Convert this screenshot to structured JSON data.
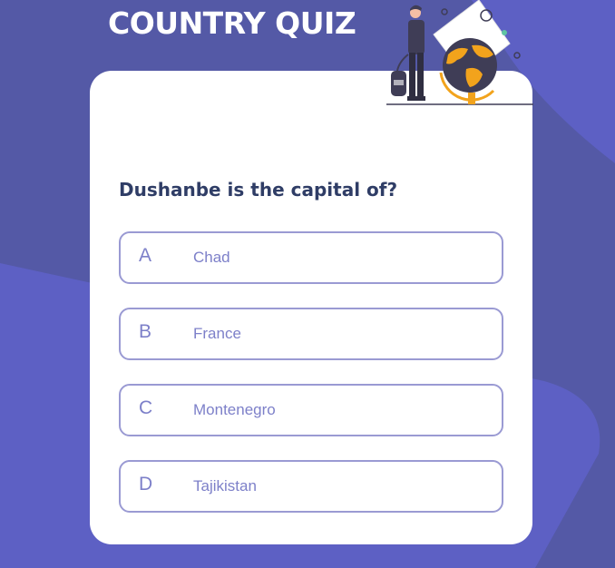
{
  "app": {
    "title": "COUNTRY QUIZ"
  },
  "quiz": {
    "question": "Dushanbe is the capital of?",
    "options": [
      {
        "letter": "A",
        "text": "Chad"
      },
      {
        "letter": "B",
        "text": "France"
      },
      {
        "letter": "C",
        "text": "Montenegro"
      },
      {
        "letter": "D",
        "text": "Tajikistan"
      }
    ]
  },
  "colors": {
    "background": "#5459a6",
    "background_accent": "#5d60c4",
    "card": "#ffffff",
    "question_text": "#2f3d66",
    "option_border": "#9a9ad3",
    "option_text": "#7d80c9",
    "globe": "#f2a31c"
  },
  "illustration": {
    "icon": "traveler-with-globe-icon"
  }
}
